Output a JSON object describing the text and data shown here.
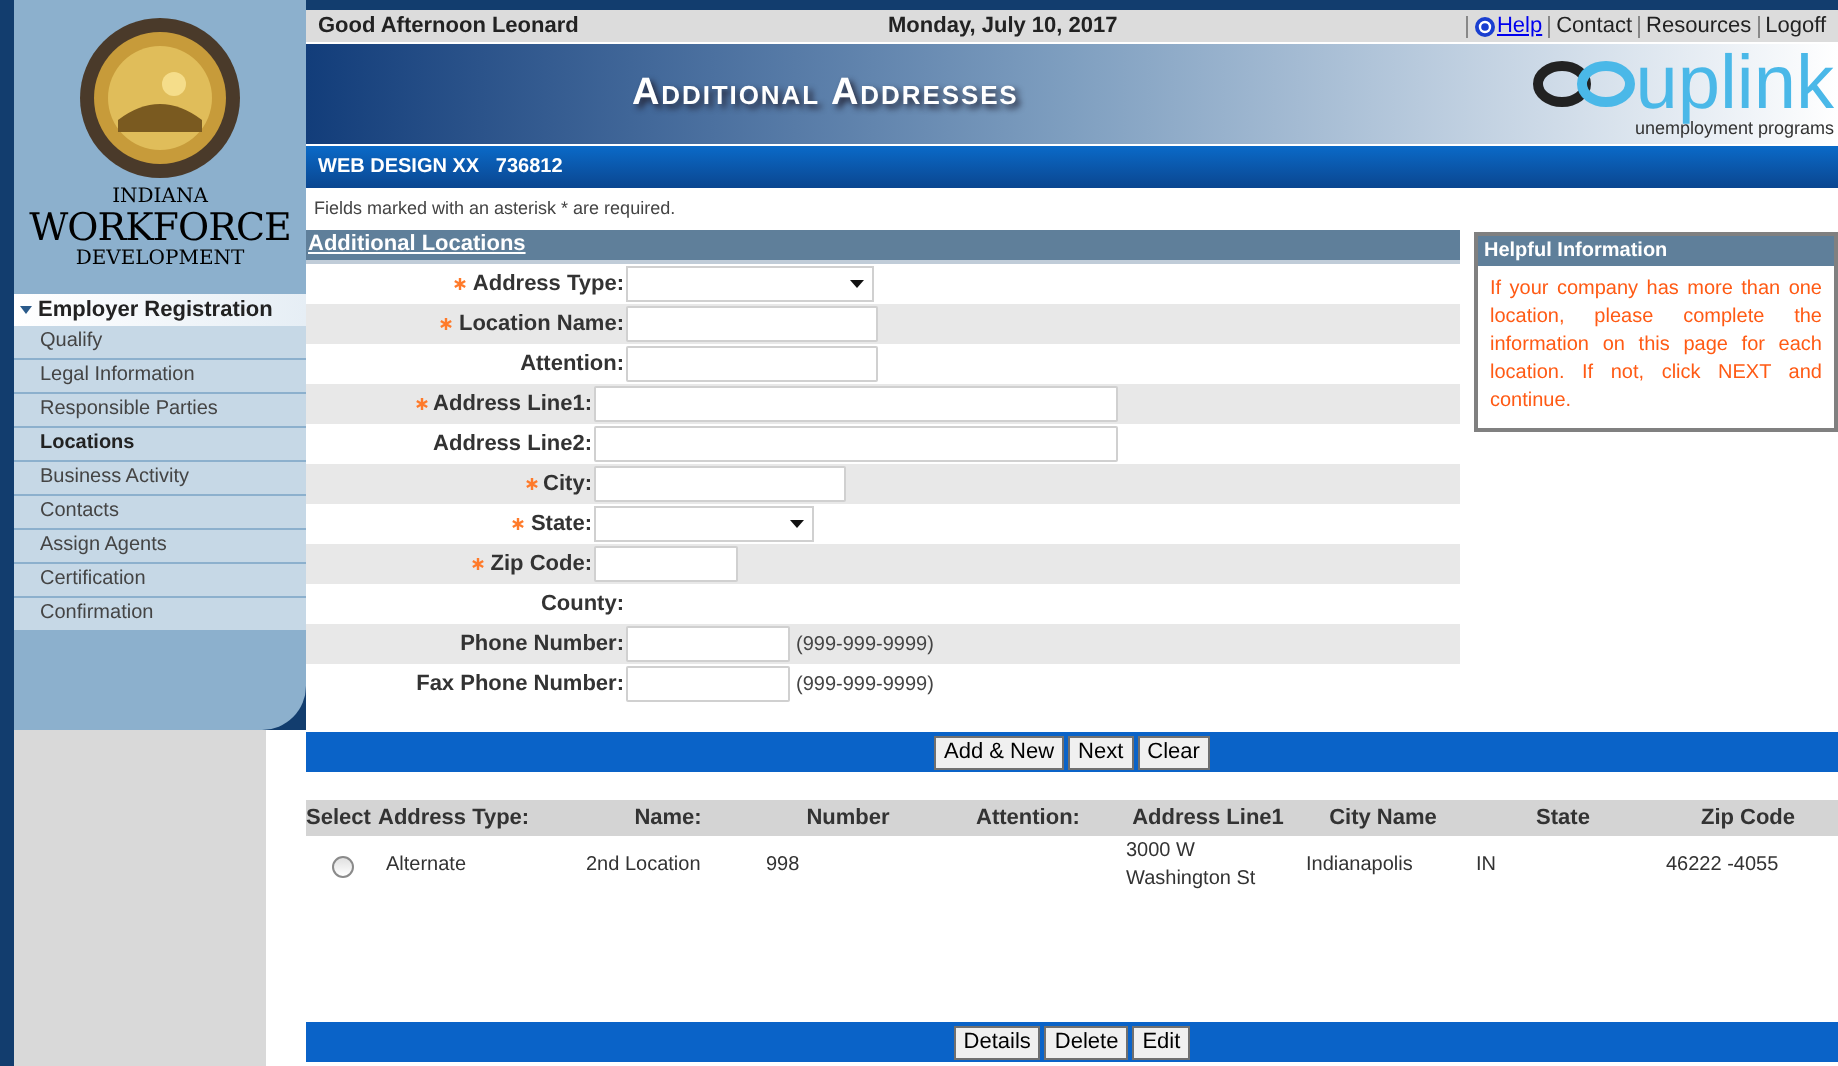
{
  "header": {
    "greeting": "Good Afternoon Leonard",
    "date": "Monday, July 10, 2017",
    "links": [
      {
        "label": "Help",
        "kind": "help"
      },
      {
        "label": "Contact",
        "kind": "plain"
      },
      {
        "label": "Resources",
        "kind": "plain"
      },
      {
        "label": "Logoff",
        "kind": "plain"
      }
    ]
  },
  "logo": {
    "line1": "INDIANA",
    "line2": "WORKFORCE",
    "line3": "DEVELOPMENT"
  },
  "banner": {
    "title": "Additional Addresses",
    "brand": "uplink",
    "tagline": "unemployment programs"
  },
  "employer_bar": "WEB DESIGN XX   736812",
  "required_note": "Fields marked with an asterisk * are required.",
  "sidebar": {
    "section": "Employer Registration",
    "expanded": true,
    "items": [
      {
        "label": "Qualify",
        "selected": false
      },
      {
        "label": "Legal Information",
        "selected": false
      },
      {
        "label": "Responsible Parties",
        "selected": false
      },
      {
        "label": "Locations",
        "selected": true
      },
      {
        "label": "Business Activity",
        "selected": false
      },
      {
        "label": "Contacts",
        "selected": false
      },
      {
        "label": "Assign Agents",
        "selected": false
      },
      {
        "label": "Certification",
        "selected": false
      },
      {
        "label": "Confirmation",
        "selected": false
      }
    ]
  },
  "form": {
    "title": "Additional Locations",
    "fields": [
      {
        "label": "Address Type:",
        "required": true,
        "kind": "select"
      },
      {
        "label": "Location Name:",
        "required": true,
        "kind": "text"
      },
      {
        "label": "Attention:",
        "required": false,
        "kind": "text"
      },
      {
        "label": "Address Line1:",
        "required": true,
        "kind": "text"
      },
      {
        "label": "Address Line2:",
        "required": false,
        "kind": "text"
      },
      {
        "label": "City:",
        "required": true,
        "kind": "text"
      },
      {
        "label": "State:",
        "required": true,
        "kind": "select"
      },
      {
        "label": "Zip Code:",
        "required": true,
        "kind": "text"
      },
      {
        "label": "County:",
        "required": false,
        "kind": "none"
      },
      {
        "label": "Phone Number:",
        "required": false,
        "kind": "text",
        "hint": "(999-999-9999)"
      },
      {
        "label": "Fax Phone Number:",
        "required": false,
        "kind": "text",
        "hint": "(999-999-9999)"
      }
    ]
  },
  "help": {
    "title": "Helpful Information",
    "text": "If your company has more than one location, please complete the information on this page for each location. If not, click NEXT and continue."
  },
  "form_buttons": [
    "Add & New",
    "Next",
    "Clear"
  ],
  "table": {
    "columns": [
      "Select",
      "Address Type:",
      "Name:",
      "Number",
      "Attention:",
      "Address Line1",
      "City Name",
      "State",
      "Zip Code"
    ],
    "rows": [
      {
        "selected": false,
        "cells": [
          "",
          "Alternate",
          "2nd Location",
          "998",
          "",
          "3000 W Washington St",
          "Indianapolis",
          "IN",
          "46222 -4055"
        ]
      }
    ]
  },
  "table_buttons": [
    "Details",
    "Delete",
    "Edit"
  ]
}
